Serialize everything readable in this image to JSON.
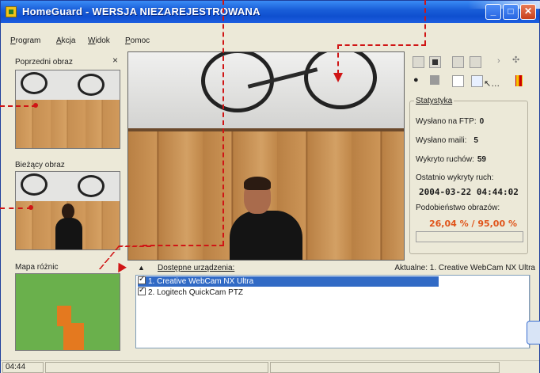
{
  "window": {
    "title": "HomeGuard - WERSJA NIEZAREJESTROWANA",
    "minimize": "_",
    "maximize": "□",
    "close": "✕"
  },
  "menu": [
    "Program",
    "Akcja",
    "Widok",
    "Pomoc"
  ],
  "left_panel": {
    "previous_label": "Poprzedni obraz",
    "close": "×",
    "current_label": "Bieżący obraz",
    "diff_label": "Mapa różnic"
  },
  "toolbar": {
    "icons": [
      "capture-icon",
      "snapshot-icon",
      "record-icon",
      "stop-icon",
      "play-icon",
      "settings-icon",
      "camera-icon",
      "grid-icon",
      "log-icon",
      "pointer-icon",
      "door-icon"
    ]
  },
  "stats": {
    "title": "Statystyka",
    "ftp_label": "Wysłano na FTP:",
    "ftp_value": "0",
    "mail_label": "Wysłano maili:",
    "mail_value": "5",
    "motion_label": "Wykryto ruchów:",
    "motion_value": "59",
    "last_motion_label": "Ostatnio wykryty ruch:",
    "last_motion_value": "2004-03-22 04:44:02",
    "similarity_label": "Podobieństwo obrazów:",
    "similarity_value": "26,04 % / 95,00 %",
    "accent_color": "#e0541a"
  },
  "devices": {
    "header": "Dostępne urządzenia:",
    "current": "Aktualne: 1. Creative WebCam NX Ultra",
    "items": [
      {
        "label": "1. Creative WebCam NX Ultra",
        "checked": true,
        "selected": true
      },
      {
        "label": "2. Logitech QuickCam PTZ",
        "checked": true,
        "selected": false
      }
    ]
  },
  "status": {
    "time": "04:44"
  }
}
